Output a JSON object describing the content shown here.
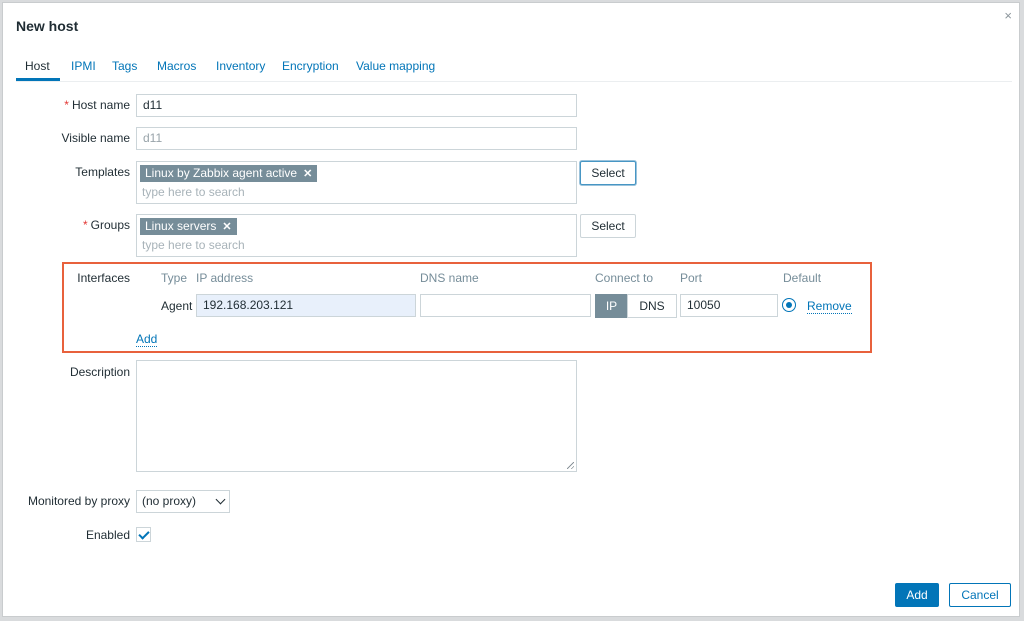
{
  "dialog": {
    "title": "New host",
    "close_glyph": "×"
  },
  "tabs": [
    {
      "label": "Host",
      "active": true
    },
    {
      "label": "IPMI"
    },
    {
      "label": "Tags"
    },
    {
      "label": "Macros"
    },
    {
      "label": "Inventory"
    },
    {
      "label": "Encryption"
    },
    {
      "label": "Value mapping"
    }
  ],
  "form": {
    "required_marker": "*",
    "host_name": {
      "label": "Host name",
      "value": "d11"
    },
    "visible_name": {
      "label": "Visible name",
      "placeholder": "d11"
    },
    "templates": {
      "label": "Templates",
      "chips": [
        "Linux by Zabbix agent active"
      ],
      "placeholder": "type here to search",
      "select_label": "Select"
    },
    "groups": {
      "label": "Groups",
      "chips": [
        "Linux servers"
      ],
      "placeholder": "type here to search",
      "select_label": "Select"
    },
    "interfaces": {
      "label": "Interfaces",
      "headers": {
        "type": "Type",
        "ip": "IP address",
        "dns": "DNS name",
        "connect": "Connect to",
        "port": "Port",
        "default": "Default"
      },
      "rows": [
        {
          "type": "Agent",
          "ip": "192.168.203.121",
          "dns": "",
          "connect_options": [
            "IP",
            "DNS"
          ],
          "connect_selected": "IP",
          "port": "10050",
          "default": true,
          "remove_label": "Remove"
        }
      ],
      "add_label": "Add"
    },
    "description": {
      "label": "Description",
      "value": ""
    },
    "proxy": {
      "label": "Monitored by proxy",
      "value": "(no proxy)"
    },
    "enabled": {
      "label": "Enabled",
      "checked": true
    }
  },
  "footer": {
    "add_label": "Add",
    "cancel_label": "Cancel"
  },
  "colors": {
    "accent": "#0275b8",
    "highlight_border": "#e8613c",
    "chip": "#768d99",
    "required": "#e33734"
  },
  "icons": {
    "close": "close-icon",
    "chip_remove": "close-icon",
    "dropdown": "chevron-down-icon",
    "checkbox": "checkmark-icon"
  }
}
